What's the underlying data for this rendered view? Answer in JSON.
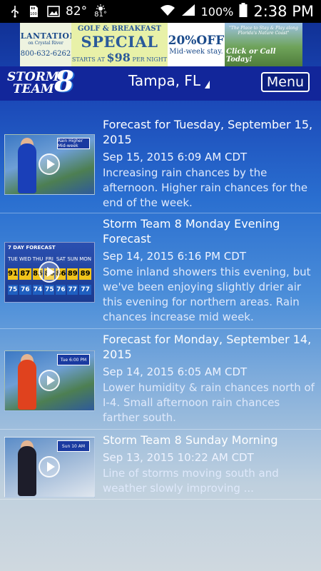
{
  "status_bar": {
    "left_icons": [
      "usb-icon",
      "sd-card-icon",
      "image-icon"
    ],
    "temperature": "82°",
    "weather_small": "81°",
    "battery_pct": "100%",
    "time": "2:38 PM"
  },
  "ad": {
    "brand": "PLANTATION",
    "brand_sub": "on Crystal River",
    "phone": "800-632-6262",
    "line1": "GOLF & BREAKFAST",
    "line2": "SPECIAL",
    "line3_prefix": "STARTS AT",
    "price": "$98",
    "line3_suffix": "PER NIGHT",
    "off": "20%OFF",
    "off_sub": "Mid-week stay.",
    "photo_caption": "\"The Place to Stay & Play along Florida's Nature Coast\"",
    "cta": "Click or Call Today!"
  },
  "header": {
    "logo_word1": "STORM",
    "logo_word2": "TEAM",
    "logo_number": "8",
    "location": "Tampa, FL",
    "menu_label": "Menu"
  },
  "videos": [
    {
      "title": "Forecast for Tuesday, September 15, 2015",
      "date": "Sep 15, 2015 6:09 AM CDT",
      "description": "Increasing rain chances by the afternoon. Higher rain chances for the end of the week.",
      "thumb_tag": "Rain Higher Mid-week",
      "presenter_color": "#1a3fb8"
    },
    {
      "title": "Storm Team 8 Monday Evening Forecast",
      "date": "Sep 14, 2015 6:16 PM CDT",
      "description": "Some inland showers this evening, but we've been enjoying slightly drier air this evening for northern areas. Rain chances increase mid week.",
      "thumb_tag": "7 DAY FORECAST",
      "forecast": {
        "days": [
          "TUE",
          "WED",
          "THU",
          "FRI",
          "SAT",
          "SUN",
          "MON"
        ],
        "highs": [
          "91",
          "87",
          "85",
          "86",
          "86",
          "89",
          "89"
        ],
        "lows": [
          "75",
          "76",
          "74",
          "75",
          "76",
          "77",
          "77"
        ]
      }
    },
    {
      "title": "Forecast for Monday, September 14, 2015",
      "date": "Sep 14, 2015 6:05 AM CDT",
      "description": "Lower humidity & rain chances north of I-4. Small afternoon rain chances farther south.",
      "thumb_tag": "Tue 6:00 PM",
      "presenter_color": "#e0421e"
    },
    {
      "title": "Storm Team 8 Sunday Morning",
      "date": "Sep 13, 2015 10:22 AM CDT",
      "description": "Line of storms moving south and weather slowly improving ...",
      "thumb_tag": "Sun 10 AM",
      "presenter_color": "#1d1d2a"
    }
  ]
}
